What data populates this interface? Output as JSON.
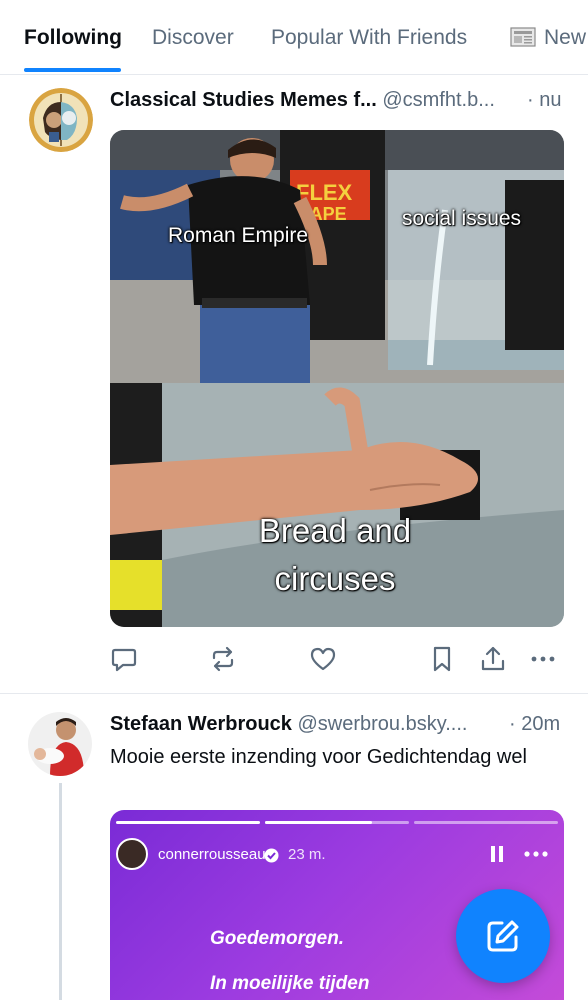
{
  "tabs": [
    {
      "label": "Following",
      "active": true
    },
    {
      "label": "Discover",
      "active": false
    },
    {
      "label": "Popular With Friends",
      "active": false
    },
    {
      "label": "New",
      "active": false
    }
  ],
  "posts": [
    {
      "author": "Classical Studies Memes f...",
      "handle": "@csmfht.b...",
      "time": "· nu",
      "meme": {
        "labels": [
          "Roman Empire",
          "social issues",
          "Bread and circuses"
        ]
      }
    },
    {
      "author": "Stefaan Werbrouck",
      "handle": "@swerbrou.bsky....",
      "time": "· 20m",
      "text": "Mooie eerste inzending voor Gedichtendag wel",
      "story": {
        "username": "connerrousseau",
        "age": "23 m.",
        "lines": [
          "Goedemorgen.",
          "In moeilijke tijden"
        ]
      }
    }
  ],
  "colors": {
    "accent": "#1083fe",
    "muted": "#5b6b7c",
    "divider": "#e6e9ee"
  },
  "icons": [
    "reply-icon",
    "repost-icon",
    "like-icon",
    "bookmark-icon",
    "share-icon",
    "more-icon",
    "compose-icon"
  ]
}
